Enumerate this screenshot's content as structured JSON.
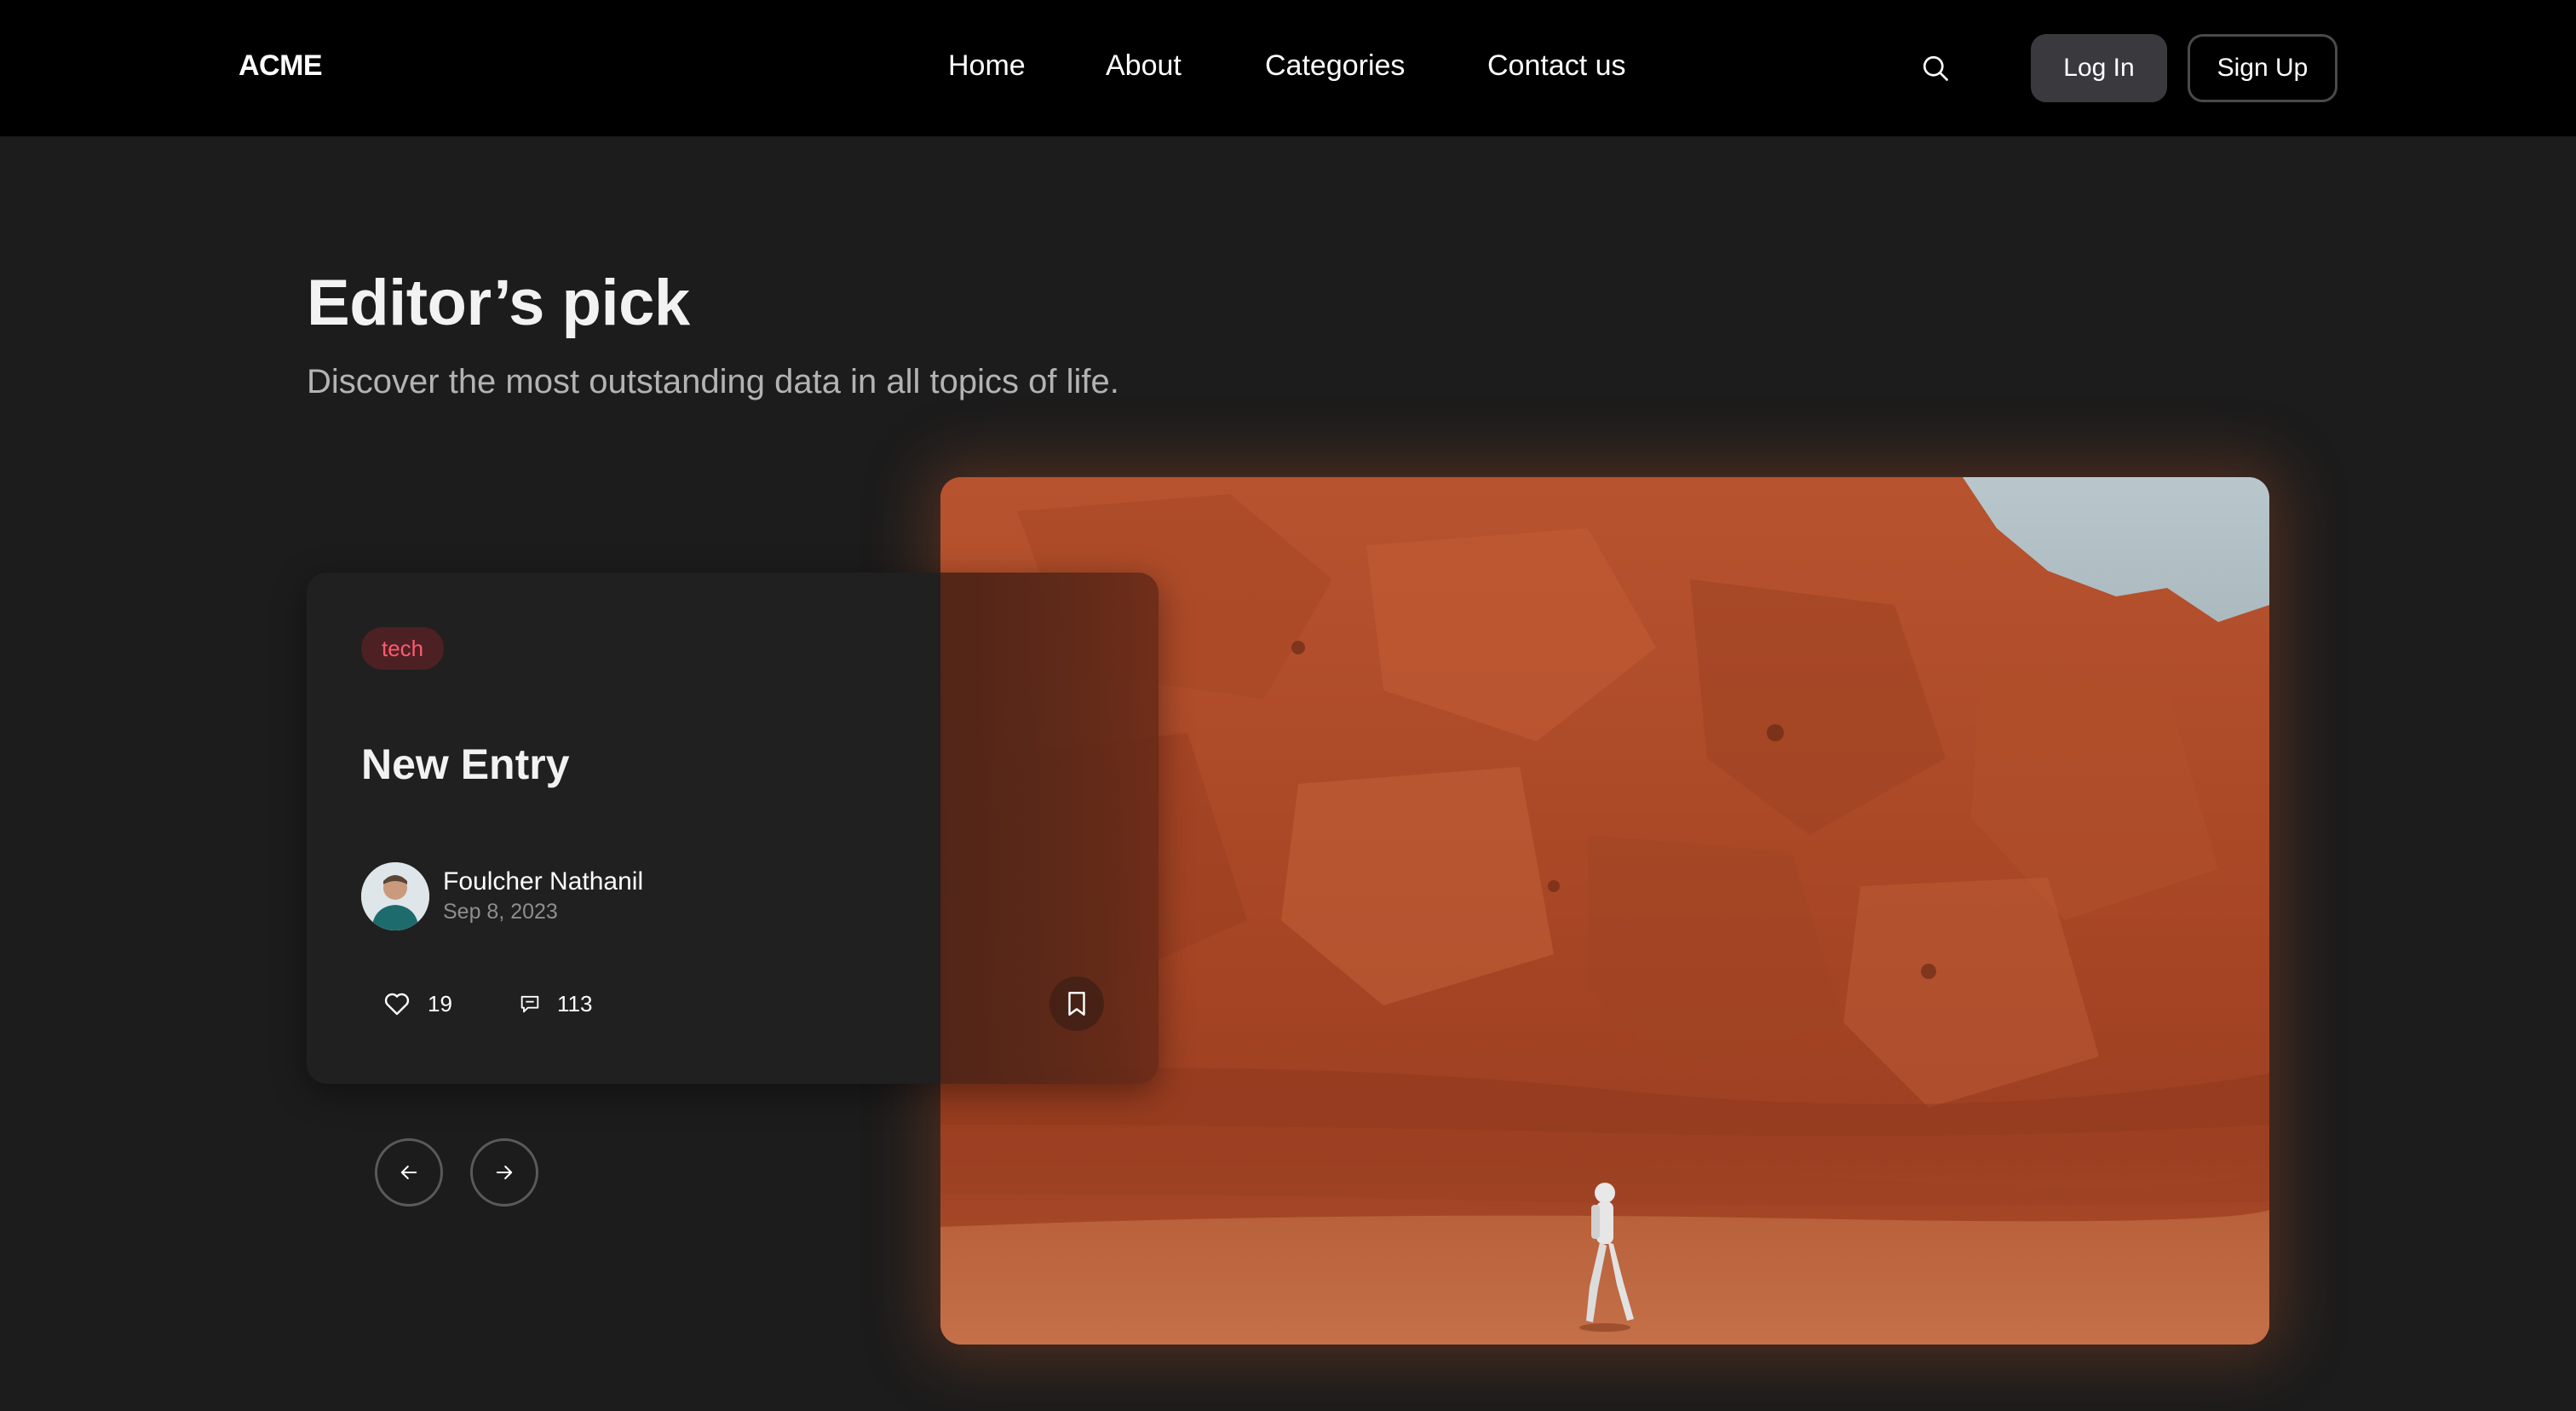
{
  "nav": {
    "logo": "ACME",
    "links": [
      {
        "label": "Home"
      },
      {
        "label": "About"
      },
      {
        "label": "Categories"
      },
      {
        "label": "Contact us"
      }
    ],
    "login_label": "Log In",
    "signup_label": "Sign Up",
    "search_icon": "search-icon"
  },
  "hero": {
    "title": "Editor’s pick",
    "subtitle": "Discover the most outstanding data in all topics of life."
  },
  "card": {
    "tag": "tech",
    "title": "New Entry",
    "author": "Foulcher Nathanil",
    "date": "Sep 8, 2023",
    "likes": "19",
    "comments": "113",
    "icons": [
      "heart-icon",
      "comment-icon",
      "bookmark-icon"
    ]
  },
  "carousel": {
    "prev_icon": "arrow-left-icon",
    "next_icon": "arrow-right-icon"
  },
  "colors": {
    "nav_bg": "#000000",
    "page_bg": "#1c1c1c",
    "card_bg": "#202020",
    "tag_bg": "#4d2024",
    "tag_text": "#ff5a6e",
    "rock": "#b5532e"
  }
}
